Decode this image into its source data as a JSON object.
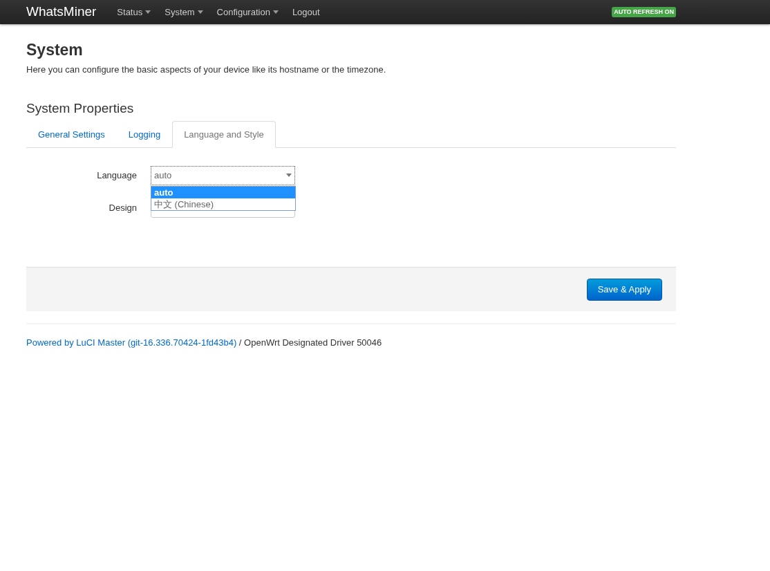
{
  "navbar": {
    "brand": "WhatsMiner",
    "menus": [
      {
        "label": "Status",
        "dropdown": true
      },
      {
        "label": "System",
        "dropdown": true
      },
      {
        "label": "Configuration",
        "dropdown": true
      },
      {
        "label": "Logout",
        "dropdown": false
      }
    ],
    "badge": "AUTO REFRESH ON"
  },
  "page": {
    "title": "System",
    "description": "Here you can configure the basic aspects of your device like its hostname or the timezone."
  },
  "section": {
    "title": "System Properties",
    "tabs": [
      {
        "label": "General Settings",
        "selected": false
      },
      {
        "label": "Logging",
        "selected": false
      },
      {
        "label": "Language and Style",
        "selected": true
      }
    ]
  },
  "fields": [
    {
      "label": "Language",
      "value": "auto",
      "expanded": true,
      "options": [
        {
          "label": "auto",
          "selected": true
        },
        {
          "label": "中文 (Chinese)",
          "selected": false
        }
      ]
    },
    {
      "label": "Design",
      "expanded": false
    }
  ],
  "actions": {
    "save_button": "Save & Apply"
  },
  "footer": {
    "link": "Powered by LuCI Master (git-16.336.70424-1fd43b4)",
    "text": " / OpenWrt Designated Driver 50046"
  }
}
